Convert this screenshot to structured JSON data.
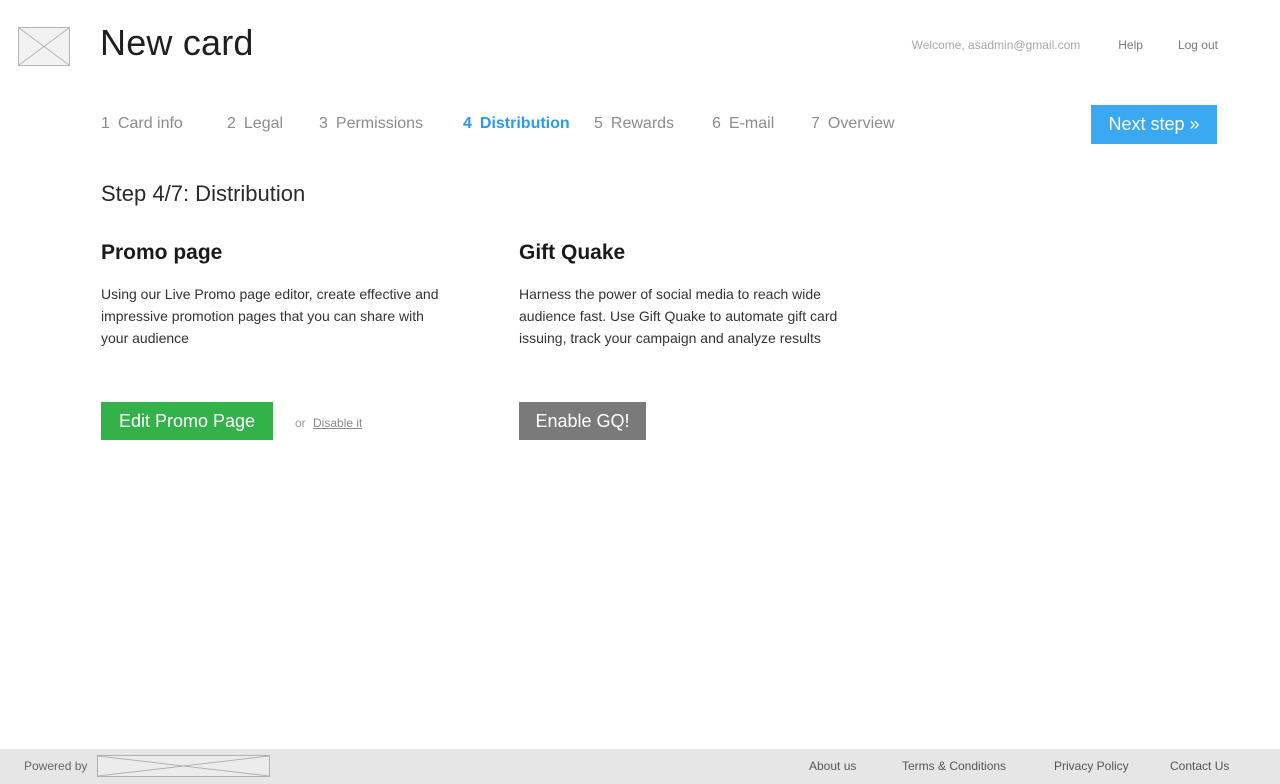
{
  "header": {
    "logo_icon": "image-placeholder-icon",
    "title": "New card",
    "welcome": "Welcome, asadmin@gmail.com",
    "help": "Help",
    "logout": "Log out"
  },
  "steps": [
    {
      "num": "1",
      "label": "Card info",
      "active": false
    },
    {
      "num": "2",
      "label": "Legal",
      "active": false
    },
    {
      "num": "3",
      "label": "Permissions",
      "active": false
    },
    {
      "num": "4",
      "label": "Distribution",
      "active": true
    },
    {
      "num": "5",
      "label": "Rewards",
      "active": false
    },
    {
      "num": "6",
      "label": "E-mail",
      "active": false
    },
    {
      "num": "7",
      "label": "Overview",
      "active": false
    }
  ],
  "next_button": "Next step »",
  "step_heading": "Step 4/7: Distribution",
  "promo": {
    "title": "Promo page",
    "description": "Using our Live Promo page editor, create effective and impressive promotion pages that you can share with your audience",
    "button": "Edit Promo Page",
    "or": "or",
    "disable": "Disable it"
  },
  "gift_quake": {
    "title": "Gift Quake",
    "description": "Harness the power of social media to reach wide audience fast. Use Gift Quake to automate gift card issuing, track your campaign and analyze results",
    "button": "Enable GQ!"
  },
  "footer": {
    "powered_by": "Powered by",
    "links": [
      "About us",
      "Terms & Conditions",
      "Privacy Policy",
      "Contact Us"
    ]
  },
  "colors": {
    "accent_blue": "#3aa9f2",
    "active_step": "#2a9be6",
    "green_button": "#33b24a",
    "gray_button": "#7a7a7a",
    "footer_bg": "#e6e6e6"
  }
}
